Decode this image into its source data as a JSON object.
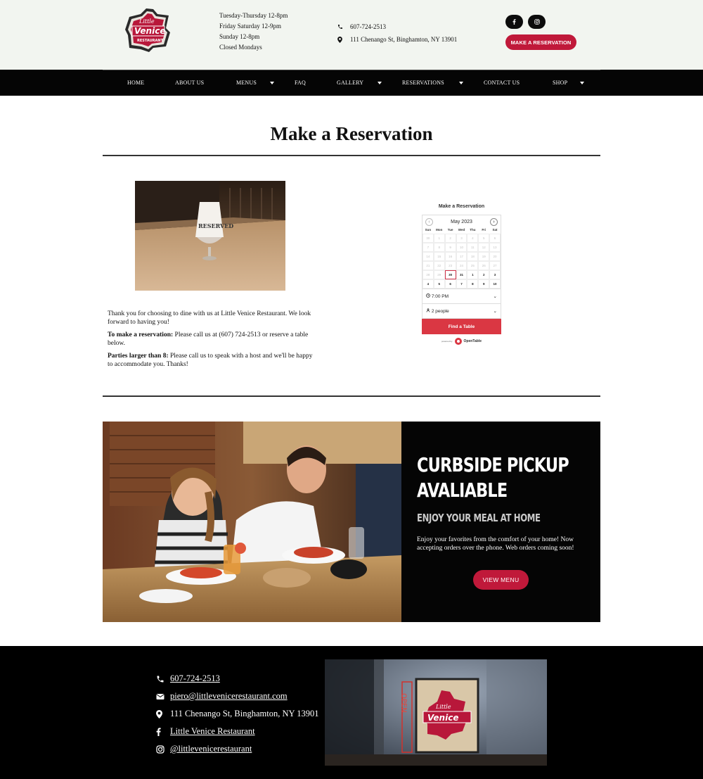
{
  "header": {
    "logo": {
      "line1": "Little",
      "line2": "Venice",
      "line3": "RESTAURANT"
    },
    "hours": [
      "Tuesday-Thursday 12-8pm",
      "Friday Saturday 12-9pm",
      "Sunday 12-8pm",
      "Closed Mondays"
    ],
    "phone": "607-724-2513",
    "address": "111 Chenango St, Binghamton, NY 13901",
    "reservation_button": "MAKE A RESERVATION",
    "social_icons": [
      "facebook-icon",
      "instagram-icon"
    ]
  },
  "nav": {
    "items": [
      {
        "label": "HOME"
      },
      {
        "label": "ABOUT US"
      },
      {
        "label": "MENUS"
      },
      {
        "label": "FAQ"
      },
      {
        "label": "GALLERY"
      },
      {
        "label": "RESERVATIONS"
      },
      {
        "label": "CONTACT US"
      },
      {
        "label": "SHOP"
      }
    ]
  },
  "main": {
    "title": "Make a Reservation",
    "photo_sign": "RESERVED",
    "intro": {
      "p1": "Thank you for choosing to dine with us at Little Venice Restaurant. We look forward to having you!",
      "p2_bold": "To make a reservation:",
      "p2_text": " Please call us at (607) 724-2513 or reserve a table below.",
      "p3_bold": "Parties larger than 8:",
      "p3_text": " Please call us to speak with a host and we'll be happy to accommodate you. Thanks!"
    }
  },
  "widget": {
    "title": "Make a Reservation",
    "month": "May",
    "year": "2023",
    "days_of_week": [
      "Sun",
      "Mon",
      "Tue",
      "Wed",
      "Thu",
      "Fri",
      "Sat"
    ],
    "weeks": [
      [
        "30",
        "1",
        "2",
        "3",
        "4",
        "5",
        "6"
      ],
      [
        "7",
        "8",
        "9",
        "10",
        "11",
        "12",
        "13"
      ],
      [
        "14",
        "15",
        "16",
        "17",
        "18",
        "19",
        "20"
      ],
      [
        "21",
        "22",
        "23",
        "24",
        "25",
        "26",
        "27"
      ],
      [
        "28",
        "29",
        "30",
        "31",
        "1",
        "2",
        "3"
      ],
      [
        "4",
        "5",
        "6",
        "7",
        "8",
        "9",
        "10"
      ]
    ],
    "selected_day": "30",
    "time": "7:00 PM",
    "party": "2 people",
    "find_button": "Find a Table",
    "brand": "OpenTable",
    "brand_prefix": "powered by"
  },
  "curbside": {
    "heading_line1": "CURBSIDE PICKUP",
    "heading_line2": "AVALIABLE",
    "subheading": "ENJOY YOUR MEAL AT HOME",
    "text": "Enjoy your favorites from the comfort of your home! Now accepting orders over the phone. Web orders coming soon!",
    "button": "VIEW MENU"
  },
  "footer": {
    "phone": "607-724-2513",
    "email": "piero@littlevenicerestaurant.com",
    "address": "111 Chenango St, Binghamton, NY 13901",
    "facebook": "Little Venice Restaurant",
    "instagram": "@littlevenicerestaurant",
    "sign_open": "OPEN"
  },
  "colors": {
    "brand_red": "#c0193a",
    "opentable_red": "#da3743",
    "header_bg": "#f2f5f0",
    "nav_bg": "#050505"
  }
}
